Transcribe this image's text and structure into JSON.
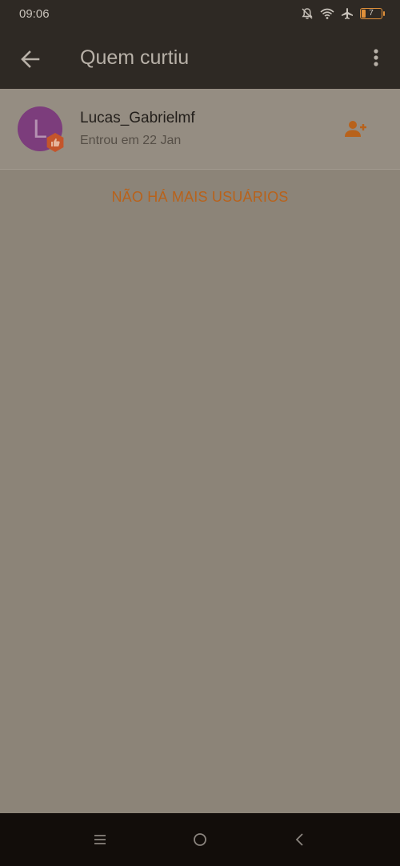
{
  "status_bar": {
    "time": "09:06",
    "battery_level": "7",
    "icons": [
      "muted-bell-icon",
      "wifi-icon",
      "airplane-icon",
      "battery-icon"
    ]
  },
  "app_bar": {
    "title": "Quem curtiu",
    "back_icon": "arrow-left-icon",
    "menu_icon": "more-vertical-icon"
  },
  "users": [
    {
      "initial": "L",
      "name": "Lucas_Gabrielmf",
      "subtitle": "Entrou em 22 Jan",
      "avatar_color": "#7c3d7c",
      "badge_icon": "thumbs-up-icon",
      "action_icon": "add-user-icon"
    }
  ],
  "end_message": "NÃO HÁ MAIS USUÁRIOS",
  "colors": {
    "accent": "#b8621b",
    "app_bar_bg": "#2e2924",
    "content_bg": "#8c8478",
    "nav_bar_bg": "#120d0a"
  }
}
